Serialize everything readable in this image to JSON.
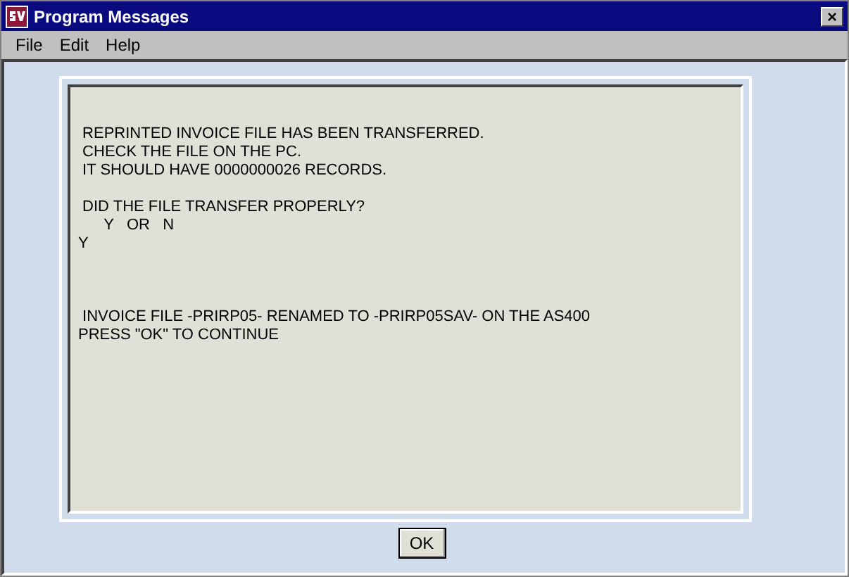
{
  "window": {
    "title": "Program Messages",
    "close": "×"
  },
  "menu": [
    "File",
    "Edit",
    "Help"
  ],
  "message_blocks": [
    [
      " REPRINTED INVOICE FILE HAS BEEN TRANSFERRED.",
      " CHECK THE FILE ON THE PC.",
      " IT SHOULD HAVE 0000000026 RECORDS."
    ],
    [
      " DID THE FILE TRANSFER PROPERLY?",
      "      Y   OR   N",
      "Y"
    ],
    [
      " INVOICE FILE -PRIRP05- RENAMED TO -PRIRP05SAV- ON THE AS400",
      "PRESS \"OK\" TO CONTINUE"
    ]
  ],
  "buttons": [
    "OK"
  ]
}
